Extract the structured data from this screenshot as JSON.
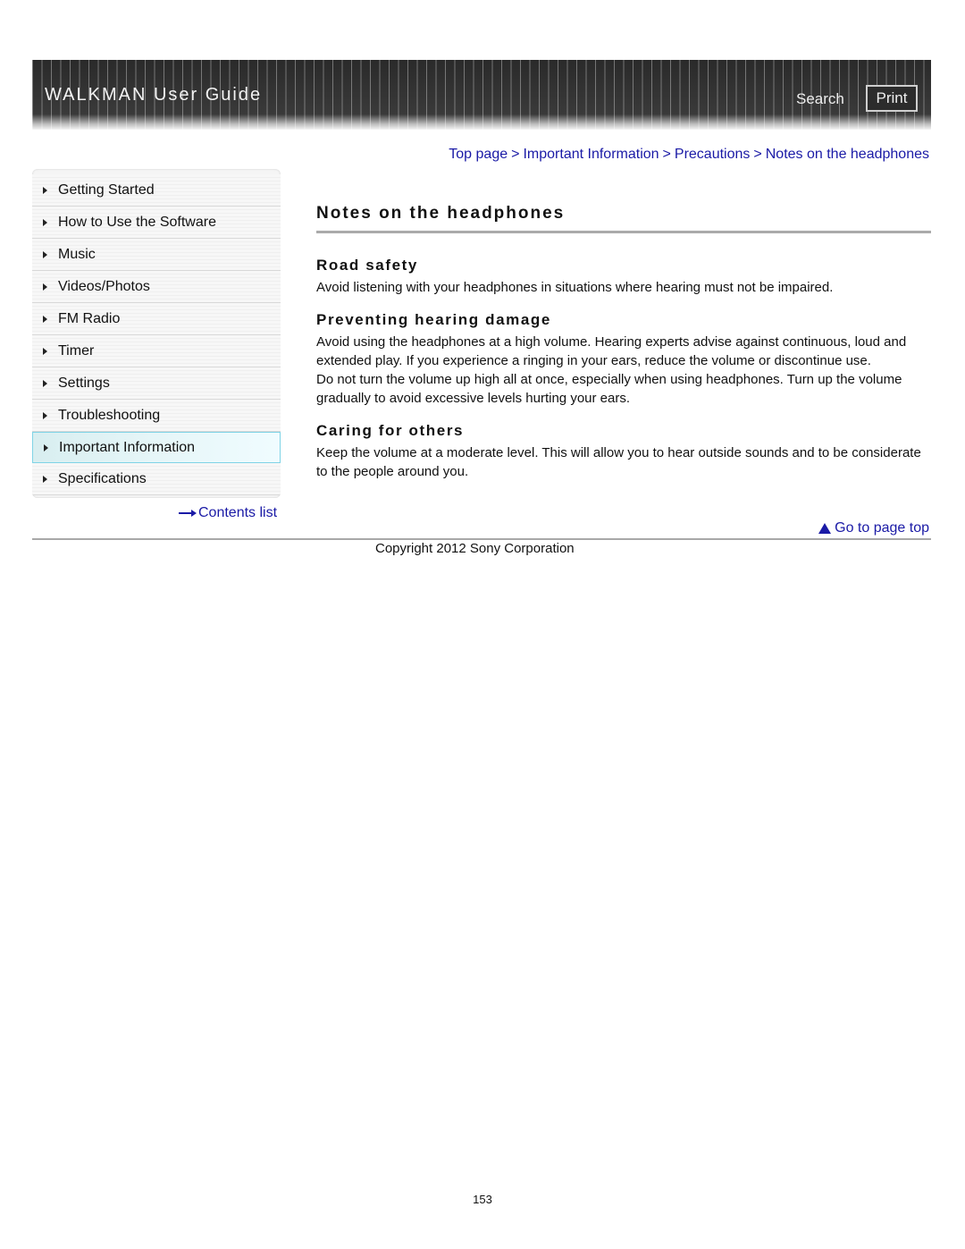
{
  "header": {
    "title": "WALKMAN User Guide",
    "search_label": "Search",
    "print_label": "Print"
  },
  "breadcrumb": {
    "items": [
      "Top page",
      "Important Information",
      "Precautions",
      "Notes on the headphones"
    ],
    "separator": ">"
  },
  "sidebar": {
    "items": [
      {
        "label": "Getting Started",
        "active": false
      },
      {
        "label": "How to Use the Software",
        "active": false
      },
      {
        "label": "Music",
        "active": false
      },
      {
        "label": "Videos/Photos",
        "active": false
      },
      {
        "label": "FM Radio",
        "active": false
      },
      {
        "label": "Timer",
        "active": false
      },
      {
        "label": "Settings",
        "active": false
      },
      {
        "label": "Troubleshooting",
        "active": false
      },
      {
        "label": "Important Information",
        "active": true
      },
      {
        "label": "Specifications",
        "active": false
      }
    ],
    "contents_link": "Contents list"
  },
  "main": {
    "title": "Notes on the headphones",
    "sections": [
      {
        "title": "Road safety",
        "paragraphs": [
          "Avoid listening with your headphones in situations where hearing must not be impaired."
        ]
      },
      {
        "title": "Preventing hearing damage",
        "paragraphs": [
          "Avoid using the headphones at a high volume. Hearing experts advise against continuous, loud and extended play. If you experience a ringing in your ears, reduce the volume or discontinue use.",
          "Do not turn the volume up high all at once, especially when using headphones. Turn up the volume gradually to avoid excessive levels hurting your ears."
        ]
      },
      {
        "title": "Caring for others",
        "paragraphs": [
          "Keep the volume at a moderate level. This will allow you to hear outside sounds and to be considerate to the people around you."
        ]
      }
    ],
    "go_to_top": "Go to page top"
  },
  "footer": {
    "copyright": "Copyright 2012 Sony Corporation",
    "page_number": "153"
  },
  "colors": {
    "link": "#1a1aa6",
    "header_bg": "#333333",
    "active_item_border": "#7fd3e6"
  }
}
